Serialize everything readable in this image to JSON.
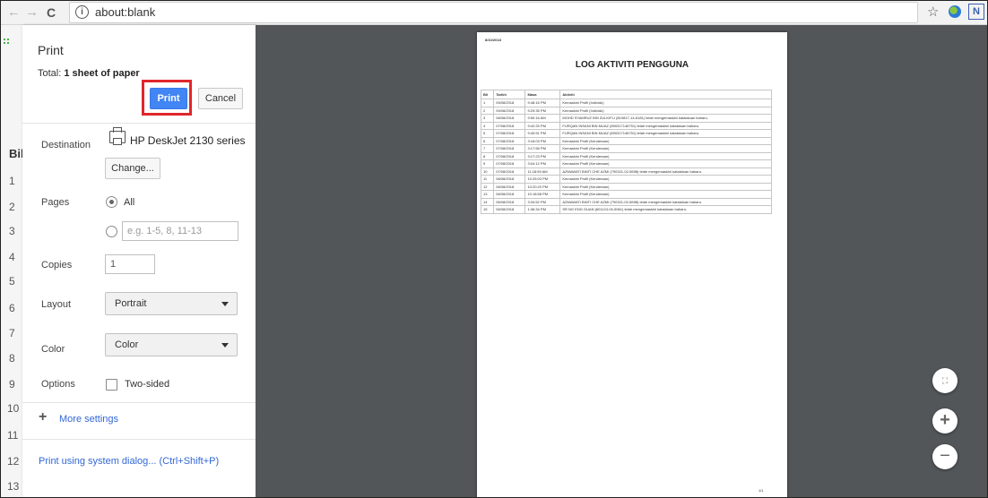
{
  "browser": {
    "back": "←",
    "forward": "→",
    "reload": "C",
    "info": "i",
    "url": "about:blank",
    "star": "☆",
    "ext2_label": "N"
  },
  "background_page": {
    "header": "Bil",
    "rows": [
      "1",
      "2",
      "3",
      "4",
      "5",
      "6",
      "7",
      "8",
      "9",
      "10",
      "11",
      "12",
      "13"
    ]
  },
  "print": {
    "title": "Print",
    "total_prefix": "Total: ",
    "total_value": "1 sheet of paper",
    "print_label": "Print",
    "cancel_label": "Cancel",
    "destination_label": "Destination",
    "destination_value": "HP DeskJet 2130 series",
    "change_label": "Change...",
    "pages_label": "Pages",
    "pages_all": "All",
    "pages_placeholder": "e.g. 1-5, 8, 11-13",
    "copies_label": "Copies",
    "copies_value": "1",
    "layout_label": "Layout",
    "layout_value": "Portrait",
    "color_label": "Color",
    "color_value": "Color",
    "options_label": "Options",
    "two_sided_label": "Two-sided",
    "more_settings_label": "More settings",
    "system_dialog_label": "Print using system dialog... (Ctrl+Shift+P)"
  },
  "preview": {
    "date": "8/10/2018",
    "title": "LOG AKTIVITI PENGGUNA",
    "page_number": "1/1",
    "columns": [
      "Bil",
      "Tarikh",
      "Masa",
      "Aktiviti"
    ],
    "rows": [
      [
        "1",
        "09/08/2018",
        "9:48:16 PM",
        "Kemaskini Profil (Individu)"
      ],
      [
        "2",
        "09/08/2018",
        "9:29:35 PM",
        "Kemaskini Profil (Individu)"
      ],
      [
        "3",
        "08/08/2018",
        "9:50:16 AM",
        "MOHD SYAMRUZ BIN ZULKIFLI (810817-14-6181) telah mengemaskini katalaluan baharu."
      ],
      [
        "4",
        "07/08/2018",
        "9:42:25 PM",
        "FURQAN INSANI BIN MUAZ (890317146751) telah mengemaskini katalaluan baharu."
      ],
      [
        "5",
        "07/08/2018",
        "9:40:51 PM",
        "FURQAN INSANI BIN MUAZ (890317146751) telah mengemaskini katalaluan baharu."
      ],
      [
        "6",
        "07/08/2018",
        "3:18:03 PM",
        "Kemaskini Profil (Kenderaan)"
      ],
      [
        "7",
        "07/08/2018",
        "3:17:56 PM",
        "Kemaskini Profil (Kenderaan)"
      ],
      [
        "8",
        "07/08/2018",
        "3:17:23 PM",
        "Kemaskini Profil (Kenderaan)"
      ],
      [
        "9",
        "07/08/2018",
        "3:04:12 PM",
        "Kemaskini Profil (Kenderaan)"
      ],
      [
        "10",
        "07/08/2018",
        "11:18:59 AM",
        "AZMAWATI BINTI CHE AZMI (790321-02-5698) telah mengemaskini katalaluan baharu."
      ],
      [
        "11",
        "06/08/2018",
        "10:25:03 PM",
        "Kemaskini Profil (Kenderaan)"
      ],
      [
        "12",
        "06/08/2018",
        "10:20:20 PM",
        "Kemaskini Profil (Kenderaan)"
      ],
      [
        "13",
        "06/08/2018",
        "10:18:58 PM",
        "Kemaskini Profil (Kenderaan)"
      ],
      [
        "14",
        "06/08/2018",
        "3:34:52 PM",
        "AZMAWATI BINTI CHE AZMI (790321-02-5698) telah mengemaskini katalaluan baharu."
      ],
      [
        "15",
        "06/08/2018",
        "1:36:34 PM",
        "SR NG ENG GUAN (601124-04-5061) telah mengemaskini katalaluan baharu."
      ]
    ],
    "zoom_fit": "⛶",
    "zoom_in": "+",
    "zoom_out": "−"
  }
}
